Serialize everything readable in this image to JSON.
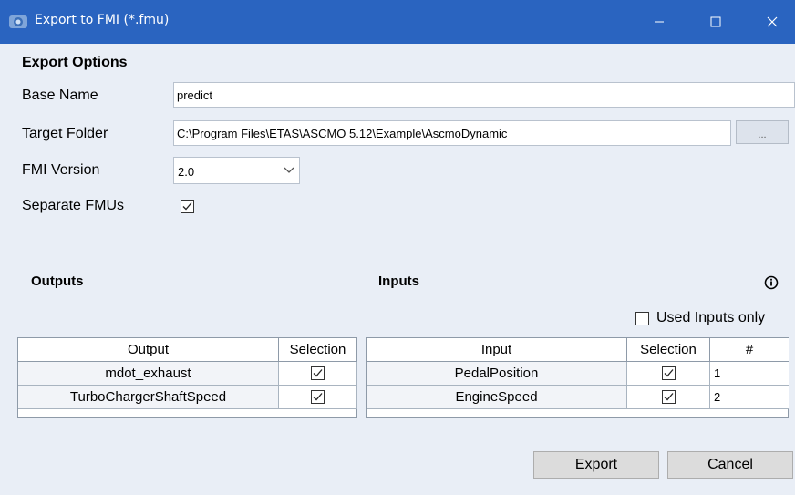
{
  "window": {
    "title": "Export to FMI (*.fmu)",
    "icons": {
      "app": "etas-app-icon",
      "minimize": "minimize-icon",
      "maximize": "maximize-icon",
      "close": "close-icon"
    }
  },
  "export_options": {
    "heading": "Export Options",
    "base_name_label": "Base Name",
    "base_name_value": "predict",
    "target_folder_label": "Target Folder",
    "target_folder_value": "C:\\Program Files\\ETAS\\ASCMO 5.12\\Example\\AscmoDynamic",
    "browse_label": "...",
    "fmi_version_label": "FMI Version",
    "fmi_version_value": "2.0",
    "separate_fmus_label": "Separate FMUs",
    "separate_fmus_checked": true
  },
  "outputs": {
    "heading": "Outputs",
    "columns": [
      "Output",
      "Selection"
    ],
    "rows": [
      {
        "name": "mdot_exhaust",
        "selected": true
      },
      {
        "name": "TurboChargerShaftSpeed",
        "selected": true
      }
    ]
  },
  "inputs": {
    "heading": "Inputs",
    "info_icon": "info-icon",
    "used_inputs_only_label": "Used Inputs only",
    "used_inputs_only_checked": false,
    "columns": [
      "Input",
      "Selection",
      "#"
    ],
    "rows": [
      {
        "name": "PedalPosition",
        "selected": true,
        "index": "1"
      },
      {
        "name": "EngineSpeed",
        "selected": true,
        "index": "2"
      }
    ]
  },
  "buttons": {
    "export": "Export",
    "cancel": "Cancel"
  },
  "colors": {
    "titlebar": "#2a64c0",
    "background": "#e9eef6",
    "button": "#dcdcdc"
  }
}
